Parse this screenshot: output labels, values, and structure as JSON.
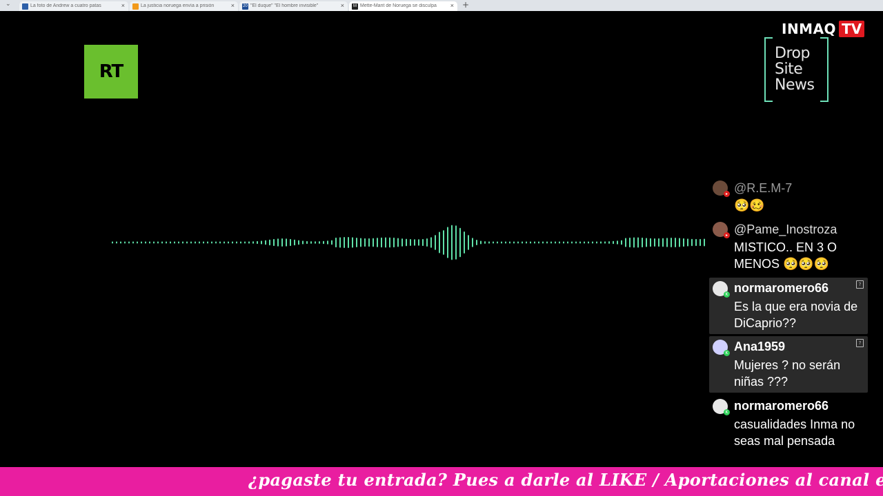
{
  "browser": {
    "tabs": [
      {
        "label": "La foto de Andrew a cuatro patas",
        "icon": "news-favicon",
        "icon_color": "#2d5fa8"
      },
      {
        "label": "La justicia noruega envía a prisión",
        "icon": "news-favicon",
        "icon_color": "#f29a1c"
      },
      {
        "label": "\"El duque\" \"El hombre invisible\"",
        "icon": "20-favicon",
        "icon_color": "#1f4e96",
        "icon_text": "20"
      },
      {
        "label": "Mette-Marit de Noruega se disculpa",
        "icon": "m-favicon",
        "icon_color": "#222222",
        "icon_text": "M"
      }
    ],
    "new_tab": "+"
  },
  "logos": {
    "rt": "RT",
    "rt_color": "#6abf2e",
    "channel_name": "INMAQ",
    "channel_tv": "TV",
    "partner": [
      "Drop",
      "Site",
      "News"
    ],
    "partner_color": "#6de0b8"
  },
  "waveform": {
    "color": "#5fe0a8"
  },
  "chat": {
    "messages": [
      {
        "user": "@R.E.M-7",
        "text": "🥺🥴",
        "faded": true,
        "avatar_color": "#6b4b3a",
        "badge": "youtube",
        "highlighted": false
      },
      {
        "user": "@Pame_Inostroza",
        "text": "MISTICO.. EN 3 O MENOS 🥺🥺🥺",
        "faded": false,
        "avatar_color": "#8a5a4a",
        "badge": "youtube",
        "highlighted": false
      },
      {
        "user": "normaromero66",
        "text": "Es la que era novia de DiCaprio??",
        "faded": false,
        "avatar_color": "#e8e8e8",
        "badge": "kick",
        "highlighted": true
      },
      {
        "user": "Ana1959",
        "text": "Mujeres ? no serán niñas ???",
        "faded": false,
        "avatar_color": "#d0d0ff",
        "avatar_letter": "A",
        "badge": "kick",
        "highlighted": true
      },
      {
        "user": "normaromero66",
        "text": "casualidades Inma no seas mal pensada",
        "faded": false,
        "avatar_color": "#e8e8e8",
        "badge": "kick",
        "highlighted": false
      }
    ]
  },
  "ticker": {
    "text": "¿pagaste tu entrada? Pues a darle al LIKE / Aportaciones al canal en https://www",
    "background": "#e91ea0"
  }
}
